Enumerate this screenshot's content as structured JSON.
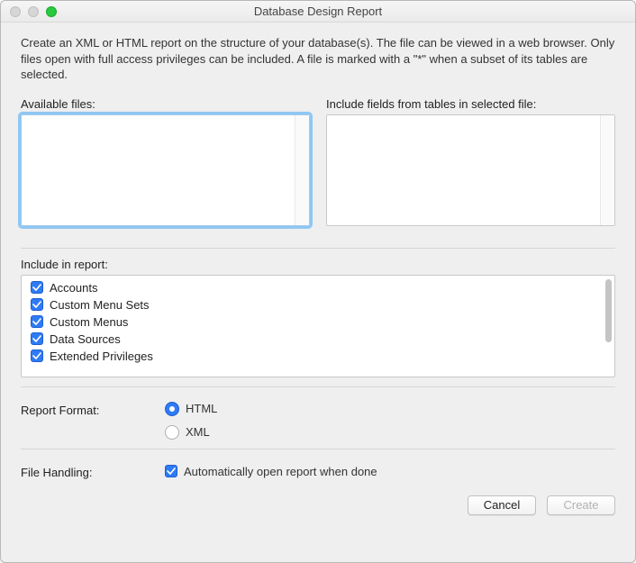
{
  "window": {
    "title": "Database Design Report"
  },
  "description": "Create an XML or HTML report on the structure of your database(s). The file can be viewed in a web browser. Only files open with full access privileges can be included. A file is marked with a \"*\" when a subset of its tables are selected.",
  "labels": {
    "availableFiles": "Available files:",
    "includeFields": "Include fields from tables in selected file:",
    "includeInReport": "Include in report:",
    "reportFormat": "Report Format:",
    "fileHandling": "File Handling:"
  },
  "includeItems": [
    {
      "label": "Accounts",
      "checked": true
    },
    {
      "label": "Custom Menu Sets",
      "checked": true
    },
    {
      "label": "Custom Menus",
      "checked": true
    },
    {
      "label": "Data Sources",
      "checked": true
    },
    {
      "label": "Extended Privileges",
      "checked": true
    }
  ],
  "reportFormat": {
    "options": {
      "html": "HTML",
      "xml": "XML"
    },
    "selected": "html"
  },
  "fileHandling": {
    "autoOpen": {
      "label": "Automatically open report when done",
      "checked": true
    }
  },
  "buttons": {
    "cancel": "Cancel",
    "create": "Create"
  }
}
